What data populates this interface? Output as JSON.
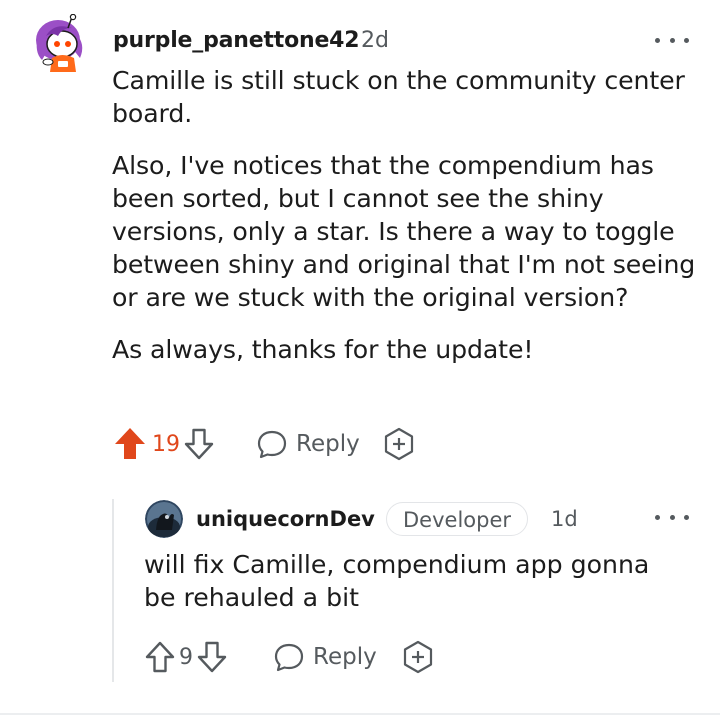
{
  "comment": {
    "username": "purple_panettone42",
    "time": "2d",
    "paragraphs": [
      "Camille is still stuck on the community center board.",
      "Also, I've notices that the compendium has been sorted, but I cannot see the shiny versions, only a star. Is there a way to toggle between shiny and original that I'm not seeing or are we stuck with the original version?",
      "As always, thanks for the update!"
    ],
    "votes": "19",
    "upvoted": true,
    "reply_label": "Reply",
    "icons": {
      "avatar": "snoo-avatar-icon",
      "more": "more-options-icon",
      "upvote": "upvote-arrow-icon",
      "downvote": "downvote-arrow-icon",
      "reply": "speech-bubble-icon",
      "award": "award-plus-icon"
    }
  },
  "reply": {
    "username": "uniquecornDev",
    "flair": "Developer",
    "time": "1d",
    "text": "will fix Camille, compendium app gonna be rehauled a bit",
    "votes": "9",
    "reply_label": "Reply"
  },
  "colors": {
    "upvote_accent": "#e0471b",
    "muted": "#555a5e",
    "text": "#1c1c1c"
  }
}
